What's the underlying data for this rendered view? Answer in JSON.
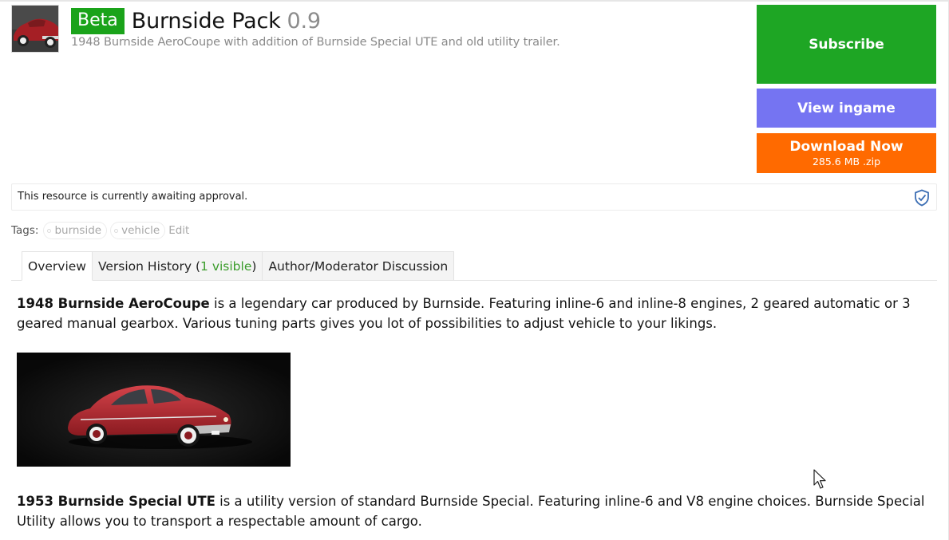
{
  "header": {
    "badge": "Beta",
    "title": "Burnside Pack",
    "version": "0.9",
    "tagline": "1948 Burnside AeroCoupe with addition of Burnside Special UTE and old utility trailer.",
    "thumbnail_icon": "car-thumbnail"
  },
  "actions": {
    "subscribe_label": "Subscribe",
    "view_ingame_label": "View ingame",
    "download_label": "Download Now",
    "download_sub": "285.6 MB .zip",
    "colors": {
      "subscribe": "#1ea624",
      "view_ingame": "#7574f2",
      "download": "#ff6a00"
    }
  },
  "notice": {
    "text": "This resource is currently awaiting approval.",
    "icon": "shield-check-icon"
  },
  "tags": {
    "label": "Tags:",
    "items": [
      "burnside",
      "vehicle"
    ],
    "edit_label": "Edit"
  },
  "tabs": {
    "overview": "Overview",
    "version_history_prefix": "Version History (",
    "version_history_count": "1 visible",
    "version_history_suffix": ")",
    "discussion": "Author/Moderator Discussion"
  },
  "content": {
    "p1_bold": "1948 Burnside AeroCoupe",
    "p1_text": " is a legendary car produced by Burnside. Featuring inline-6 and inline-8 engines, 2 geared automatic or 3 geared manual gearbox. Various tuning parts gives you lot of possibilities to adjust vehicle to your likings.",
    "image_icon": "red-coupe-render",
    "p2_bold": "1953 Burnside Special UTE",
    "p2_text": " is a utility version of standard Burnside Special. Featuring inline-6 and V8 engine choices. Burnside Special Utility allows you to transport a respectable amount of cargo."
  }
}
